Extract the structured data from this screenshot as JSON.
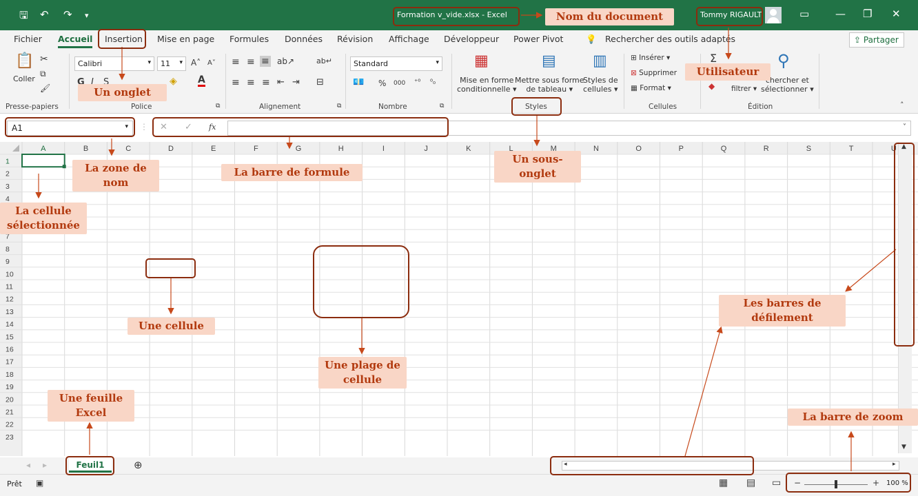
{
  "titlebar": {
    "doc_title": "Formation v_vide.xlsx  -  Excel",
    "user": "Tommy RIGAULT"
  },
  "tabs": [
    "Fichier",
    "Accueil",
    "Insertion",
    "Mise en page",
    "Formules",
    "Données",
    "Révision",
    "Affichage",
    "Développeur",
    "Power Pivot"
  ],
  "search_label": "Rechercher des outils adaptés",
  "share_label": "Partager",
  "ribbon": {
    "clipboard_group": "Presse-papiers",
    "paste_label": "Coller",
    "font_group": "Police",
    "font_name": "Calibri",
    "font_size": "11",
    "align_group": "Alignement",
    "number_group": "Nombre",
    "number_format": "Standard",
    "percent": "%",
    "thousands": "000",
    "styles_group": "Styles",
    "cond_format": [
      "Mise en forme",
      "conditionnelle"
    ],
    "table_format": [
      "Mettre sous forme",
      "de tableau"
    ],
    "cell_styles": [
      "Styles de",
      "cellules"
    ],
    "cells_group": "Cellules",
    "insert": "Insérer",
    "delete": "Supprimer",
    "format": "Format",
    "edit_group": "Édition",
    "filter": "filtrer",
    "find": [
      "chercher et",
      "sélectionner"
    ]
  },
  "namebox": "A1",
  "fx": "fx",
  "columns": [
    "A",
    "B",
    "C",
    "D",
    "E",
    "F",
    "G",
    "H",
    "I",
    "J",
    "K",
    "L",
    "M",
    "N",
    "O",
    "P",
    "Q",
    "R",
    "S",
    "T",
    "U"
  ],
  "rows": [
    "1",
    "2",
    "3",
    "4",
    "5",
    "6",
    "7",
    "8",
    "9",
    "10",
    "11",
    "12",
    "13",
    "14",
    "15",
    "16",
    "17",
    "18",
    "19",
    "20",
    "21",
    "22",
    "23"
  ],
  "sheet": "Feuil1",
  "status": "Prêt",
  "zoom": "100 %",
  "zoom_percent": 100,
  "annotations": {
    "doc": "Nom du document",
    "user": "Utilisateur",
    "tab": "Un onglet",
    "namezone": "La zone de nom",
    "formula": "La barre de formule",
    "subtab": "Un sous-onglet",
    "selcell": "La cellule sélectionnée",
    "cell": "Une cellule",
    "range": "Une plage de cellule",
    "sheet": "Une feuille Excel",
    "scrollbars": "Les barres de défilement",
    "zoombar": "La barre de zoom"
  },
  "colors": {
    "excel_green": "#217346",
    "annotation_bg": "#f9d6c6",
    "annotation_text": "#b23a0f",
    "highlight": "#8b2c0e"
  }
}
